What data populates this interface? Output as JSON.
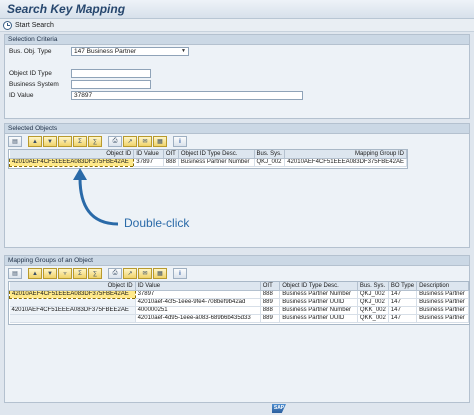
{
  "window": {
    "title": "Search Key Mapping"
  },
  "app_toolbar": {
    "start_search": "Start Search"
  },
  "selection_criteria": {
    "title": "Selection Criteria",
    "bus_obj_type_label": "Bus. Obj. Type",
    "bus_obj_type_value": "147  Business Partner",
    "object_id_type_label": "Object ID Type",
    "object_id_type_value": "",
    "business_system_label": "Business System",
    "business_system_value": "",
    "id_value_label": "ID Value",
    "id_value_value": "37897"
  },
  "selected_objects": {
    "title": "Selected Objects",
    "columns": [
      "Object ID",
      "ID Value",
      "OIT",
      "Object ID Type Desc.",
      "Bus. Sys.",
      "Mapping Group ID"
    ],
    "rows": [
      {
        "object_id": "42010AEF4CF51EEEA083DF375FBE42AE",
        "id_value": "37897",
        "oit": "888",
        "desc": "Business Partner Number",
        "bus_sys": "QKJ_002",
        "group_id": "42010AEF4CF51EEEA083DF375FBE42AE"
      }
    ]
  },
  "callout": {
    "text": "Double-click"
  },
  "mapping_groups": {
    "title": "Mapping Groups of an Object",
    "columns": [
      "Object ID",
      "ID Value",
      "OIT",
      "Object ID Type Desc.",
      "Bus. Sys.",
      "BO Type",
      "Description"
    ],
    "rows": [
      {
        "object_id": "42010AEF4CF51EEEA083DF375FBE42AE",
        "id_value": "37897",
        "oit": "888",
        "desc": "Business Partner Number",
        "bus_sys": "QKJ_002",
        "bo_type": "147",
        "description": "Business Partner"
      },
      {
        "object_id": "",
        "id_value": "42010aef-4cf5-1eee-9fe4-708bef9b42ad",
        "oit": "889",
        "desc": "Business Partner UUID",
        "bus_sys": "QKJ_002",
        "bo_type": "147",
        "description": "Business Partner"
      },
      {
        "object_id": "42010AEF4CF51EEEA083DF375FBEE2AE",
        "id_value": "400000251",
        "oit": "888",
        "desc": "Business Partner Number",
        "bus_sys": "QKK_002",
        "bo_type": "147",
        "description": "Business Partner"
      },
      {
        "object_id": "",
        "id_value": "42010aef-4d95-1eee-a083-689b6b435d33",
        "oit": "889",
        "desc": "Business Partner UUID",
        "bus_sys": "QKK_002",
        "bo_type": "147",
        "description": "Business Partner"
      }
    ]
  },
  "icons": [
    "clock-icon",
    "dropdown-arrow-icon",
    "sort-asc-icon",
    "filter-icon",
    "sum-icon",
    "print-icon",
    "export-icon",
    "layout-icon",
    "info-icon"
  ],
  "footer": {
    "logo": "SAP"
  },
  "colors": {
    "title": "#27476e",
    "selected_cell": "#ffe98a",
    "callout": "#2a6aa8"
  }
}
